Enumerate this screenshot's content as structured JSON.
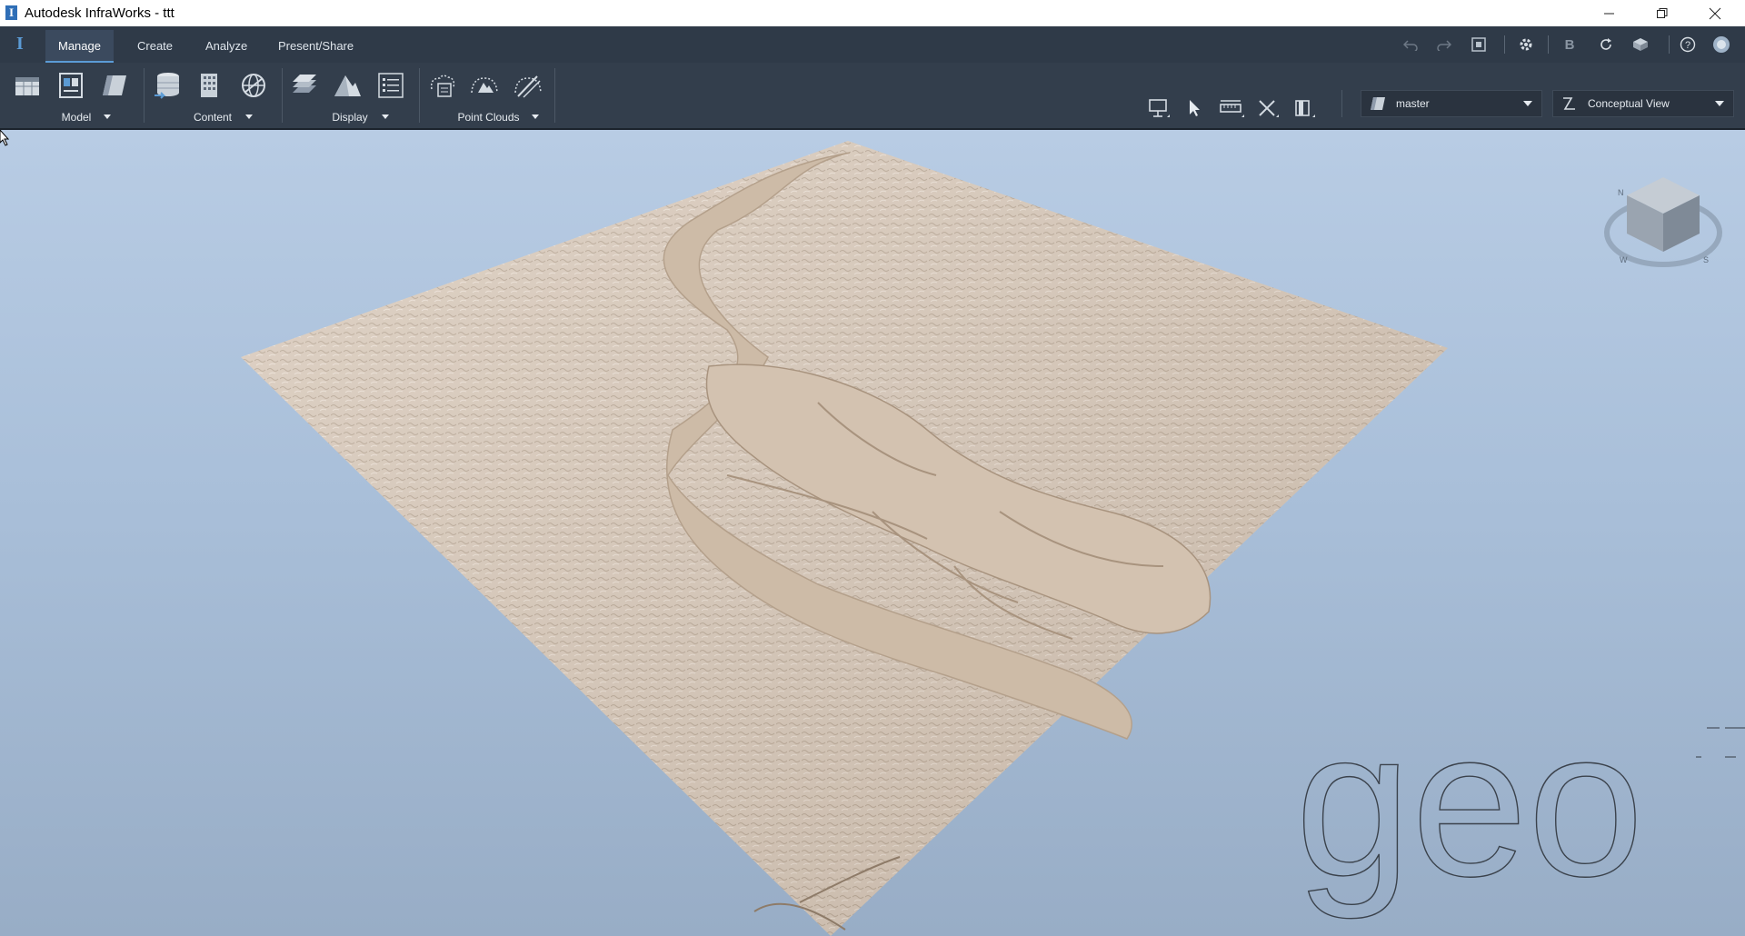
{
  "window": {
    "title": "Autodesk InfraWorks - ttt",
    "controls": [
      "minimize-icon",
      "restore-icon",
      "close-icon"
    ]
  },
  "tabs": [
    {
      "label": "Manage",
      "active": true
    },
    {
      "label": "Create",
      "active": false
    },
    {
      "label": "Analyze",
      "active": false
    },
    {
      "label": "Present/Share",
      "active": false
    }
  ],
  "quick_access": [
    "undo-icon",
    "redo-icon",
    "fullscreen-icon",
    "settings-icon",
    "bim360-icon",
    "sync-icon",
    "cloud-model-icon",
    "help-icon",
    "user-icon"
  ],
  "ribbon": {
    "groups": [
      {
        "label": "Model"
      },
      {
        "label": "Content"
      },
      {
        "label": "Display"
      },
      {
        "label": "Point Clouds"
      }
    ],
    "view_tools": [
      "presentation-icon",
      "select-icon",
      "measure-icon",
      "crop-icon",
      "view-options-icon"
    ],
    "proposal_dropdown": {
      "value": "master"
    },
    "view_dropdown": {
      "value": "Conceptual View"
    }
  },
  "viewport": {
    "viewcube_compass": [
      "N",
      "W",
      "S"
    ],
    "watermark": "geo",
    "colors": {
      "terrain": "#d8c8b9",
      "river": "#cfbda9",
      "sky_top": "#b8cce4",
      "sky_bottom": "#98adc6"
    }
  }
}
